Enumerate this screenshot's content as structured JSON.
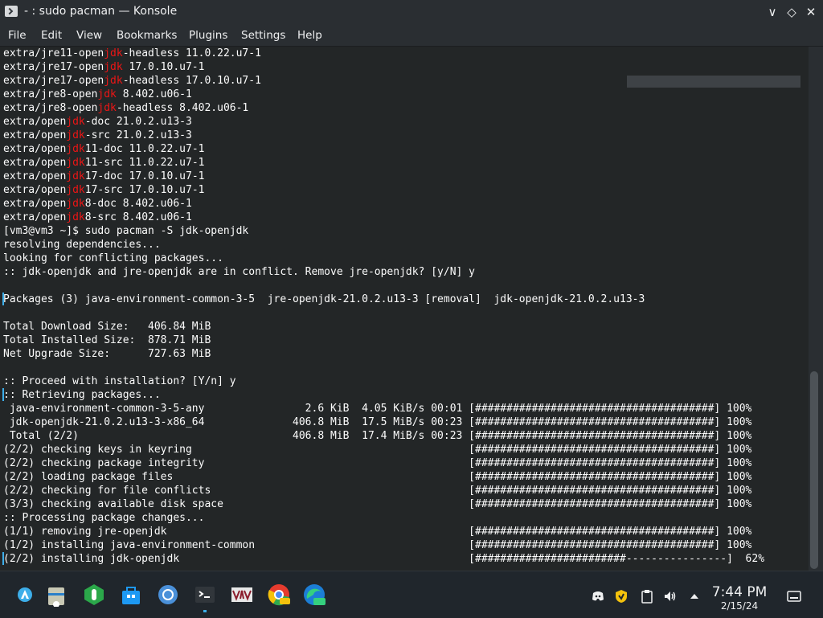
{
  "window": {
    "title": "- : sudo pacman — Konsole",
    "controls": [
      "∨",
      "◇",
      "✕"
    ]
  },
  "menu": [
    "File",
    "Edit",
    "View",
    "Bookmarks",
    "Plugins",
    "Settings",
    "Help"
  ],
  "terminal": {
    "lines": [
      [
        [
          "extra/jre11-open",
          ""
        ],
        [
          "jdk",
          "red"
        ],
        [
          "-headless 11.0.22.u7-1",
          ""
        ]
      ],
      [
        [
          "extra/jre17-open",
          ""
        ],
        [
          "jdk",
          "red"
        ],
        [
          " 17.0.10.u7-1",
          ""
        ]
      ],
      [
        [
          "extra/jre17-open",
          ""
        ],
        [
          "jdk",
          "red"
        ],
        [
          "-headless 17.0.10.u7-1",
          ""
        ]
      ],
      [
        [
          "extra/jre8-open",
          ""
        ],
        [
          "jdk",
          "red"
        ],
        [
          " 8.402.u06-1",
          ""
        ]
      ],
      [
        [
          "extra/jre8-open",
          ""
        ],
        [
          "jdk",
          "red"
        ],
        [
          "-headless 8.402.u06-1",
          ""
        ]
      ],
      [
        [
          "extra/open",
          ""
        ],
        [
          "jdk",
          "red"
        ],
        [
          "-doc 21.0.2.u13-3",
          ""
        ]
      ],
      [
        [
          "extra/open",
          ""
        ],
        [
          "jdk",
          "red"
        ],
        [
          "-src 21.0.2.u13-3",
          ""
        ]
      ],
      [
        [
          "extra/open",
          ""
        ],
        [
          "jdk",
          "red"
        ],
        [
          "11-doc 11.0.22.u7-1",
          ""
        ]
      ],
      [
        [
          "extra/open",
          ""
        ],
        [
          "jdk",
          "red"
        ],
        [
          "11-src 11.0.22.u7-1",
          ""
        ]
      ],
      [
        [
          "extra/open",
          ""
        ],
        [
          "jdk",
          "red"
        ],
        [
          "17-doc 17.0.10.u7-1",
          ""
        ]
      ],
      [
        [
          "extra/open",
          ""
        ],
        [
          "jdk",
          "red"
        ],
        [
          "17-src 17.0.10.u7-1",
          ""
        ]
      ],
      [
        [
          "extra/open",
          ""
        ],
        [
          "jdk",
          "red"
        ],
        [
          "8-doc 8.402.u06-1",
          ""
        ]
      ],
      [
        [
          "extra/open",
          ""
        ],
        [
          "jdk",
          "red"
        ],
        [
          "8-src 8.402.u06-1",
          ""
        ]
      ],
      [
        [
          "[vm3@vm3 ~]$ sudo pacman -S jdk-openjdk",
          ""
        ]
      ],
      [
        [
          "resolving dependencies...",
          ""
        ]
      ],
      [
        [
          "looking for conflicting packages...",
          ""
        ]
      ],
      [
        [
          ":: jdk-openjdk and jre-openjdk are in conflict. Remove jre-openjdk? [y/N] y",
          ""
        ]
      ],
      [
        [
          "",
          ""
        ]
      ],
      [
        [
          "Packages (3) java-environment-common-3-5  jre-openjdk-21.0.2.u13-3 [removal]  jdk-openjdk-21.0.2.u13-3",
          ""
        ]
      ],
      [
        [
          "",
          ""
        ]
      ],
      [
        [
          "Total Download Size:   406.84 MiB",
          ""
        ]
      ],
      [
        [
          "Total Installed Size:  878.71 MiB",
          ""
        ]
      ],
      [
        [
          "Net Upgrade Size:      727.63 MiB",
          ""
        ]
      ],
      [
        [
          "",
          ""
        ]
      ],
      [
        [
          ":: Proceed with installation? [Y/n] y",
          ""
        ]
      ],
      [
        [
          ":: Retrieving packages...",
          ""
        ]
      ],
      [
        [
          " java-environment-common-3-5-any                2.6 KiB  4.05 KiB/s 00:01 [######################################] 100%",
          ""
        ]
      ],
      [
        [
          " jdk-openjdk-21.0.2.u13-3-x86_64              406.8 MiB  17.5 MiB/s 00:23 [######################################] 100%",
          ""
        ]
      ],
      [
        [
          " Total (2/2)                                  406.8 MiB  17.4 MiB/s 00:23 [######################################] 100%",
          ""
        ]
      ],
      [
        [
          "(2/2) checking keys in keyring                                            [######################################] 100%",
          ""
        ]
      ],
      [
        [
          "(2/2) checking package integrity                                          [######################################] 100%",
          ""
        ]
      ],
      [
        [
          "(2/2) loading package files                                               [######################################] 100%",
          ""
        ]
      ],
      [
        [
          "(2/2) checking for file conflicts                                         [######################################] 100%",
          ""
        ]
      ],
      [
        [
          "(3/3) checking available disk space                                       [######################################] 100%",
          ""
        ]
      ],
      [
        [
          ":: Processing package changes...",
          ""
        ]
      ],
      [
        [
          "(1/1) removing jre-openjdk                                                [######################################] 100%",
          ""
        ]
      ],
      [
        [
          "(1/2) installing java-environment-common                                  [######################################] 100%",
          ""
        ]
      ],
      [
        [
          "(2/2) installing jdk-openjdk                                              [########################----------------]  62%",
          ""
        ]
      ]
    ]
  },
  "taskbar": {
    "clock": "7:44 PM",
    "date": "2/15/24",
    "apps": [
      "application-launcher-icon",
      "file-manager-icon",
      "discover-icon",
      "system-settings-icon",
      "chromium-icon",
      "konsole-icon",
      "vmware-icon",
      "chrome-dev-icon",
      "edge-dev-icon"
    ],
    "tray": [
      "discord-icon",
      "shield-icon",
      "clipboard-icon",
      "volume-icon",
      "expand-tray-icon",
      "show-desktop-icon"
    ]
  },
  "colors": {
    "terminal_bg": "#232627",
    "chrome_bg": "#2a2e32",
    "highlight_red": "#ed1515",
    "accent": "#3daee9"
  }
}
